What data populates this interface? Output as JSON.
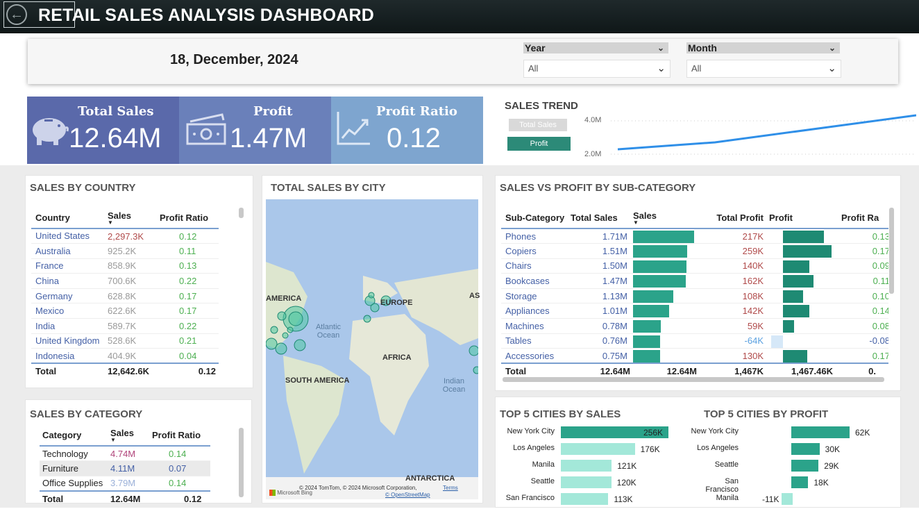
{
  "app": {
    "title": "RETAIL SALES ANALYSIS DASHBOARD"
  },
  "filters": {
    "date": "18, December, 2024",
    "year_label": "Year",
    "year_value": "All",
    "month_label": "Month",
    "month_value": "All"
  },
  "cards": [
    {
      "label": "Total Sales",
      "value": "12.64M",
      "icon": "piggy-bank-icon",
      "color": "#5a69aa"
    },
    {
      "label": "Profit",
      "value": "1.47M",
      "icon": "cash-icon",
      "color": "#6a80ba"
    },
    {
      "label": "Profit Ratio",
      "value": "0.12",
      "icon": "line-growth-icon",
      "color": "#7ea5cf"
    }
  ],
  "trend": {
    "title": "SALES TREND",
    "btn_sales": "Total Sales",
    "btn_profit": "Profit",
    "ytick_top": "4.0M",
    "ytick_bottom": "2.0M"
  },
  "country": {
    "title": "SALES BY COUNTRY",
    "headers": [
      "Country",
      "Sales",
      "Profit Ratio"
    ],
    "rows": [
      [
        "United States",
        "2,297.3K",
        "0.12"
      ],
      [
        "Australia",
        "925.2K",
        "0.11"
      ],
      [
        "France",
        "858.9K",
        "0.13"
      ],
      [
        "China",
        "700.6K",
        "0.22"
      ],
      [
        "Germany",
        "628.8K",
        "0.17"
      ],
      [
        "Mexico",
        "622.6K",
        "0.17"
      ],
      [
        "India",
        "589.7K",
        "0.22"
      ],
      [
        "United Kingdom",
        "528.6K",
        "0.21"
      ],
      [
        "Indonesia",
        "404.9K",
        "0.04"
      ]
    ],
    "total": [
      "Total",
      "12,642.6K",
      "0.12"
    ]
  },
  "category": {
    "title": "SALES BY CATEGORY",
    "headers": [
      "Category",
      "Sales",
      "Profit Ratio"
    ],
    "rows": [
      [
        "Technology",
        "4.74M",
        "0.14"
      ],
      [
        "Furniture",
        "4.11M",
        "0.07"
      ],
      [
        "Office Supplies",
        "3.79M",
        "0.14"
      ]
    ],
    "total": [
      "Total",
      "12.64M",
      "0.12"
    ]
  },
  "map": {
    "title": "TOTAL SALES BY CITY",
    "labels": {
      "america": "AMERICA",
      "europe": "EUROPE",
      "as": "AS",
      "africa": "AFRICA",
      "south_america": "SOUTH AMERICA",
      "antarctica": "ANTARCTICA",
      "atlantic": "Atlantic\nOcean",
      "indian": "Indian\nOcean"
    },
    "credit": "© 2024 TomTom, © 2024 Microsoft Corporation,",
    "terms": "Terms",
    "osm": "© OpenStreetMap",
    "logo": "Microsoft Bing"
  },
  "subcat": {
    "title": "SALES VS PROFIT BY SUB-CATEGORY",
    "headers": [
      "Sub-Category",
      "Total Sales",
      "Sales",
      "Total Profit",
      "Profit",
      "Profit Ra"
    ],
    "rows": [
      {
        "name": "Phones",
        "sales_label": "1.71M",
        "sales": 1.71,
        "profit_label": "217K",
        "profit": 217,
        "ratio": "0.13"
      },
      {
        "name": "Copiers",
        "sales_label": "1.51M",
        "sales": 1.51,
        "profit_label": "259K",
        "profit": 259,
        "ratio": "0.17"
      },
      {
        "name": "Chairs",
        "sales_label": "1.50M",
        "sales": 1.5,
        "profit_label": "140K",
        "profit": 140,
        "ratio": "0.09"
      },
      {
        "name": "Bookcases",
        "sales_label": "1.47M",
        "sales": 1.47,
        "profit_label": "162K",
        "profit": 162,
        "ratio": "0.11"
      },
      {
        "name": "Storage",
        "sales_label": "1.13M",
        "sales": 1.13,
        "profit_label": "108K",
        "profit": 108,
        "ratio": "0.10"
      },
      {
        "name": "Appliances",
        "sales_label": "1.01M",
        "sales": 1.01,
        "profit_label": "142K",
        "profit": 142,
        "ratio": "0.14"
      },
      {
        "name": "Machines",
        "sales_label": "0.78M",
        "sales": 0.78,
        "profit_label": "59K",
        "profit": 59,
        "ratio": "0.08"
      },
      {
        "name": "Tables",
        "sales_label": "0.76M",
        "sales": 0.76,
        "profit_label": "-64K",
        "profit": -64,
        "ratio": "-0.08"
      },
      {
        "name": "Accessories",
        "sales_label": "0.75M",
        "sales": 0.75,
        "profit_label": "130K",
        "profit": 130,
        "ratio": "0.17"
      }
    ],
    "total": {
      "name": "Total",
      "total_sales": "12.64M",
      "sales": "12.64M",
      "total_profit": "1,467K",
      "profit": "1,467.46K",
      "ratio": "0."
    }
  },
  "top_sales": {
    "title": "TOP 5 CITIES BY SALES",
    "items": [
      {
        "city": "New York City",
        "label": "256K",
        "value": 256
      },
      {
        "city": "Los Angeles",
        "label": "176K",
        "value": 176
      },
      {
        "city": "Manila",
        "label": "121K",
        "value": 121
      },
      {
        "city": "Seattle",
        "label": "120K",
        "value": 120
      },
      {
        "city": "San Francisco",
        "label": "113K",
        "value": 113
      }
    ]
  },
  "top_profit": {
    "title": "TOP 5 CITIES BY PROFIT",
    "items": [
      {
        "city": "New York City",
        "label": "62K",
        "value": 62
      },
      {
        "city": "Los Angeles",
        "label": "30K",
        "value": 30
      },
      {
        "city": "Seattle",
        "label": "29K",
        "value": 29
      },
      {
        "city": "San Francisco",
        "label": "18K",
        "value": 18
      },
      {
        "city": "Manila",
        "label": "-11K",
        "value": -11
      }
    ]
  },
  "colors": {
    "header": "#1a2426",
    "teal": "#2ba38a",
    "teal_dark": "#1e8a73",
    "teal_light": "#9ee6d6",
    "trend_line": "#2f8fe8",
    "link_blue": "#4460a6"
  }
}
